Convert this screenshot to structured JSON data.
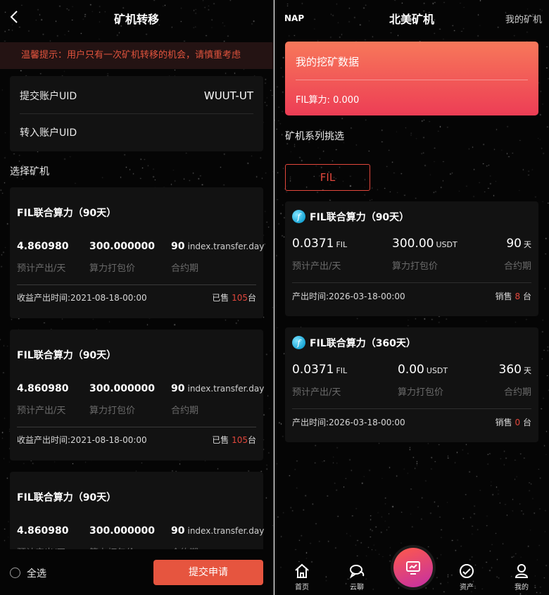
{
  "left": {
    "header": {
      "title": "矿机转移"
    },
    "notice": "温馨提示：用户只有一次矿机转移的机会，请慎重考虑",
    "uid": {
      "submit_label": "提交账户UID",
      "submit_value": "WUUT-UT",
      "transfer_label": "转入账户UID"
    },
    "select_label": "选择矿机",
    "machines": [
      {
        "name": "FIL联合算力（90天）",
        "output": "4.860980",
        "price": "300.000000",
        "period": "90",
        "period_unit": "index.transfer.day",
        "output_cap": "预计产出/天",
        "price_cap": "算力打包价",
        "period_cap": "合约期",
        "time_label": "收益产出时间:2021-08-18-00:00",
        "sold_prefix": "已售",
        "sold": "105",
        "sold_unit": "台"
      },
      {
        "name": "FIL联合算力（90天）",
        "output": "4.860980",
        "price": "300.000000",
        "period": "90",
        "period_unit": "index.transfer.day",
        "output_cap": "预计产出/天",
        "price_cap": "算力打包价",
        "period_cap": "合约期",
        "time_label": "收益产出时间:2021-08-18-00:00",
        "sold_prefix": "已售",
        "sold": "105",
        "sold_unit": "台"
      },
      {
        "name": "FIL联合算力（90天）",
        "output": "4.860980",
        "price": "300.000000",
        "period": "90",
        "period_unit": "index.transfer.day",
        "output_cap": "预计产出/天",
        "price_cap": "算力打包价",
        "period_cap": "合约期"
      }
    ],
    "bottom": {
      "select_all": "全选",
      "submit": "提交申请"
    }
  },
  "right": {
    "header": {
      "brand": "NAP",
      "title": "北美矿机",
      "mine": "我的矿机"
    },
    "mining": {
      "title": "我的挖矿数据",
      "fil_power": "FIL算力: 0.000"
    },
    "series_label": "矿机系列挑选",
    "tab": "FIL",
    "products": [
      {
        "name": "FIL联合算力（90天）",
        "output": "0.0371",
        "output_unit": "FIL",
        "price": "300.00",
        "price_unit": "USDT",
        "days": "90",
        "days_unit": "天",
        "output_cap": "预计产出/天",
        "price_cap": "算力打包价",
        "days_cap": "合约期",
        "time": "产出时间:2026-03-18-00:00",
        "sold_prefix": "销售",
        "sold": "8",
        "sold_unit": "台"
      },
      {
        "name": "FIL联合算力（360天）",
        "output": "0.0371",
        "output_unit": "FIL",
        "price": "0.00",
        "price_unit": "USDT",
        "days": "360",
        "days_unit": "天",
        "output_cap": "预计产出/天",
        "price_cap": "算力打包价",
        "days_cap": "合约期",
        "time": "产出时间:2026-03-18-00:00",
        "sold_prefix": "销售",
        "sold": "0",
        "sold_unit": "台"
      }
    ],
    "tabbar": [
      {
        "label": "首页",
        "icon": "home-icon"
      },
      {
        "label": "云聊",
        "icon": "chat-icon"
      },
      {
        "label": "资产",
        "icon": "assets-icon"
      },
      {
        "label": "我的",
        "icon": "user-icon"
      }
    ]
  },
  "colors": {
    "accent": "#e6553f",
    "sold_red": "#e2473c",
    "card_bg": "#121212",
    "page_bg": "#050505"
  }
}
